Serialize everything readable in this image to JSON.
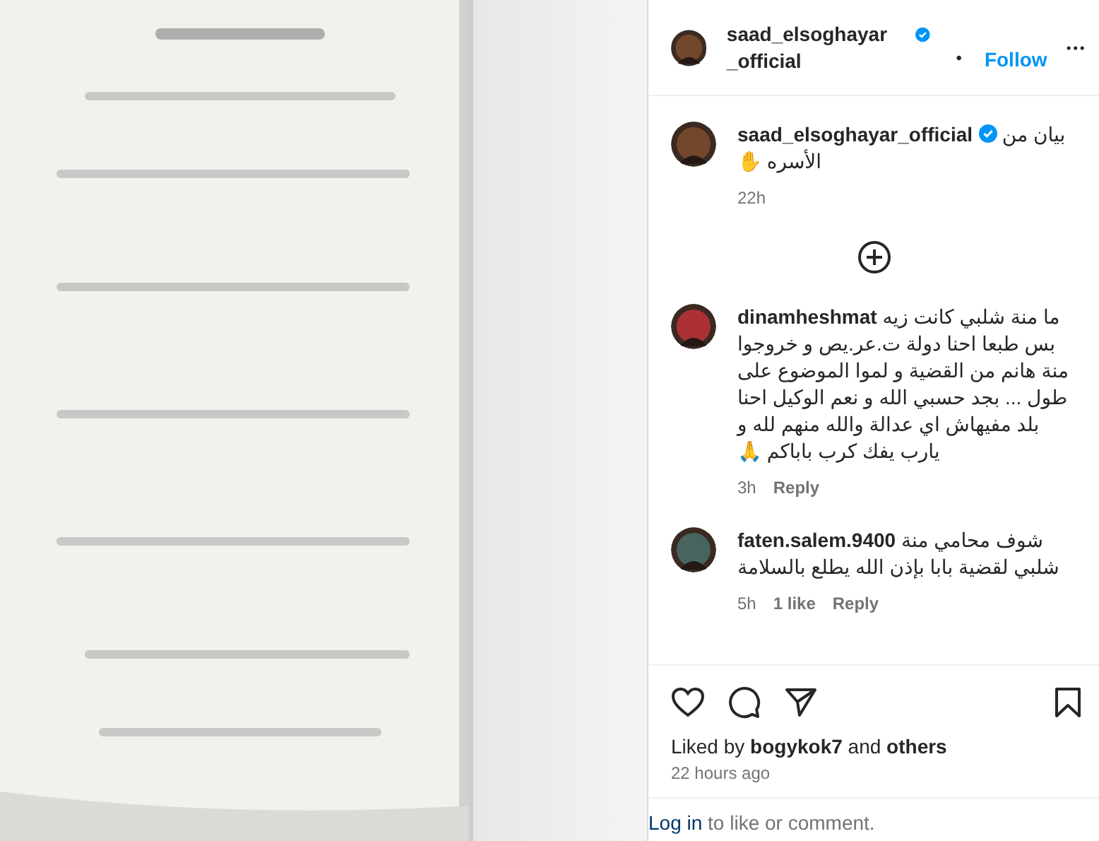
{
  "header": {
    "username": "saad_elsoghayar_official",
    "verified": true,
    "separator": "•",
    "follow": "Follow"
  },
  "caption": {
    "username": "saad_elsoghayar_official",
    "verified": true,
    "text": "بيان من الأسره ✋",
    "time": "22h"
  },
  "comments": [
    {
      "username": "dinamheshmat",
      "text": "ما منة شلبي كانت زيه بس طبعا احنا دولة ت.عر.يص و خروجوا منة هانم من القضية و لموا الموضوع على طول ... بجد حسبي الله و نعم الوكيل احنا بلد مفيهاش اي عدالة والله منهم لله و يارب يفك كرب باباكم 🙏",
      "time": "3h",
      "reply": "Reply"
    },
    {
      "username": "faten.salem.9400",
      "text": "شوف محامي منة شلبي لقضية بابا بإذن الله يطلع بالسلامة",
      "time": "5h",
      "likes": "1 like",
      "reply": "Reply"
    }
  ],
  "likes": "Liked by **bogykok7** and **others**",
  "posted": "22 hours ago",
  "login": {
    "link": "Log in",
    "text": " to like or comment."
  }
}
